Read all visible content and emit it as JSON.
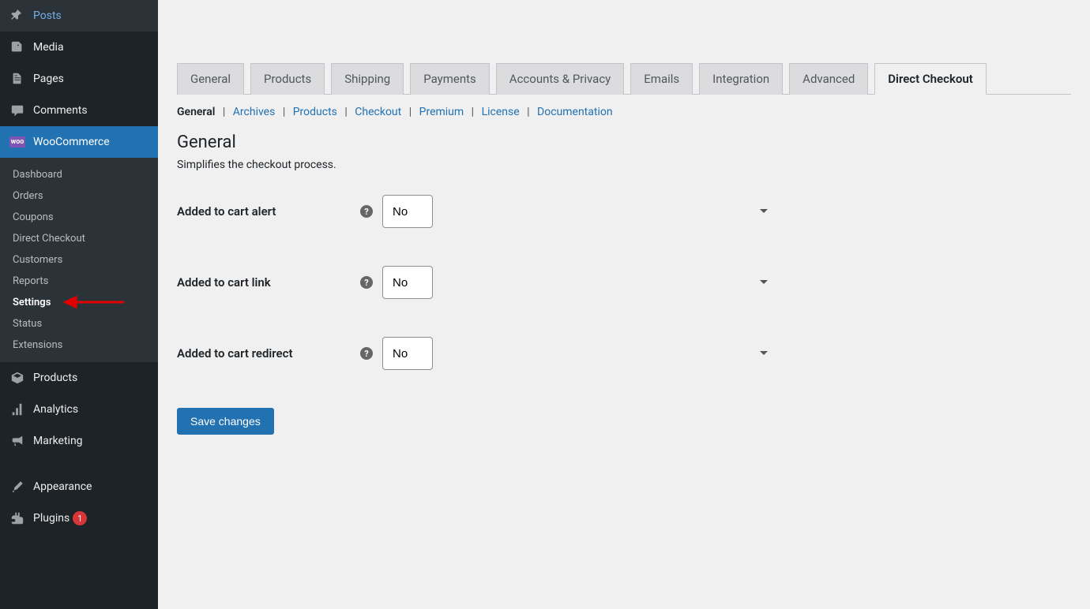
{
  "sidebar": {
    "items": [
      {
        "label": "Posts",
        "icon": "pin"
      },
      {
        "label": "Media",
        "icon": "media"
      },
      {
        "label": "Pages",
        "icon": "pages"
      },
      {
        "label": "Comments",
        "icon": "comment"
      },
      {
        "label": "WooCommerce",
        "icon": "woo",
        "active": true
      },
      {
        "label": "Products",
        "icon": "box"
      },
      {
        "label": "Analytics",
        "icon": "analytics"
      },
      {
        "label": "Marketing",
        "icon": "megaphone"
      },
      {
        "label": "Appearance",
        "icon": "brush"
      },
      {
        "label": "Plugins",
        "icon": "plugin",
        "badge": "1"
      }
    ],
    "submenu": [
      {
        "label": "Dashboard"
      },
      {
        "label": "Orders"
      },
      {
        "label": "Coupons"
      },
      {
        "label": "Direct Checkout"
      },
      {
        "label": "Customers"
      },
      {
        "label": "Reports"
      },
      {
        "label": "Settings",
        "current": true
      },
      {
        "label": "Status"
      },
      {
        "label": "Extensions"
      }
    ]
  },
  "tabs": [
    "General",
    "Products",
    "Shipping",
    "Payments",
    "Accounts & Privacy",
    "Emails",
    "Integration",
    "Advanced",
    "Direct Checkout"
  ],
  "active_tab": "Direct Checkout",
  "subtabs": [
    "General",
    "Archives",
    "Products",
    "Checkout",
    "Premium",
    "License",
    "Documentation"
  ],
  "active_subtab": "General",
  "section": {
    "title": "General",
    "description": "Simplifies the checkout process."
  },
  "fields": [
    {
      "label": "Added to cart alert",
      "value": "No"
    },
    {
      "label": "Added to cart link",
      "value": "No"
    },
    {
      "label": "Added to cart redirect",
      "value": "No"
    }
  ],
  "save_label": "Save changes"
}
